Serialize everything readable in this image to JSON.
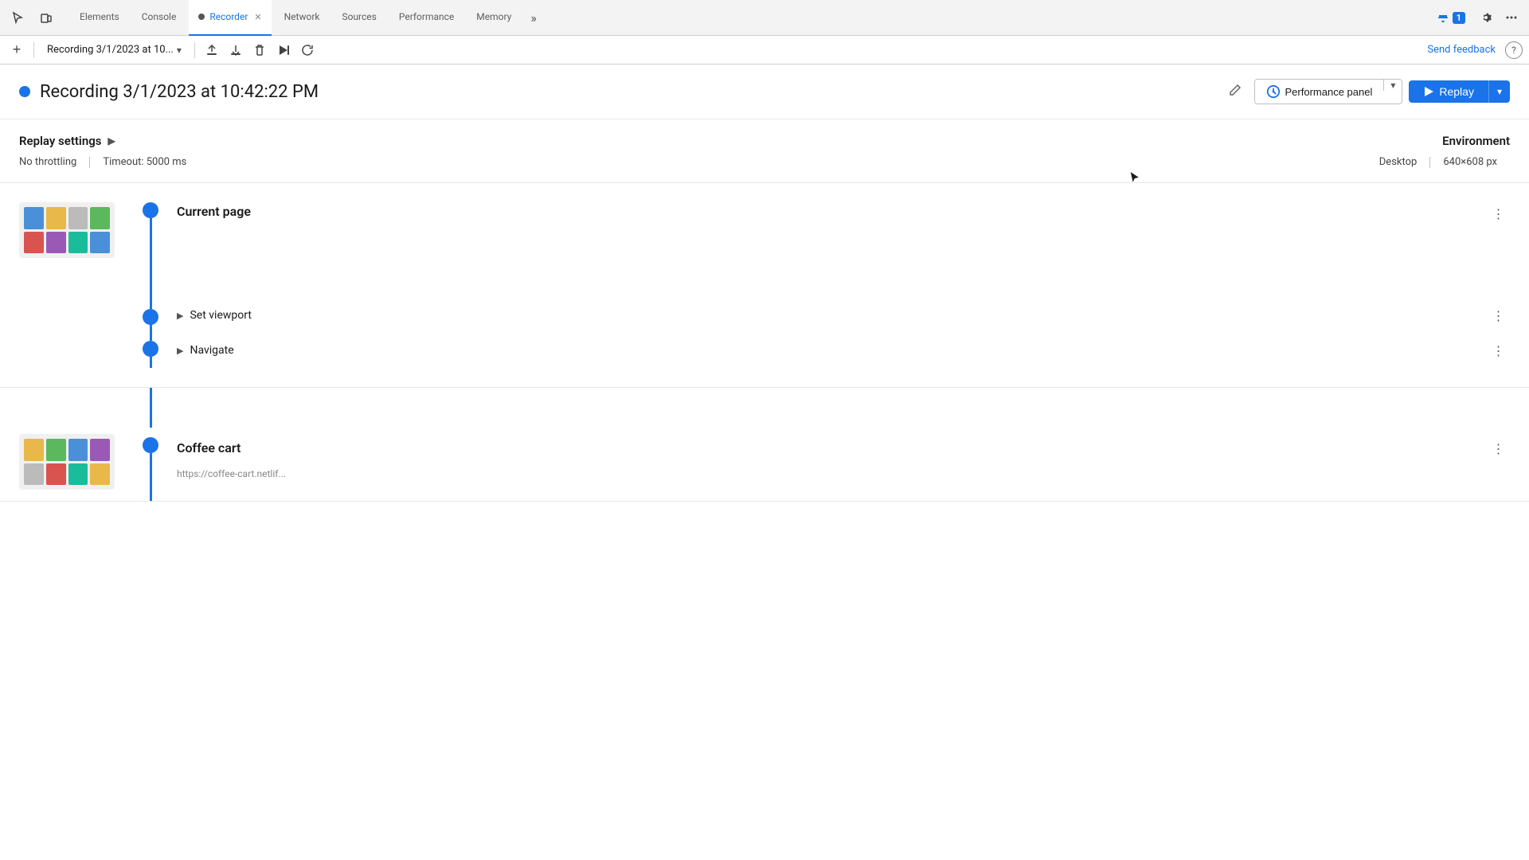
{
  "tabs": {
    "items": [
      {
        "label": "Elements",
        "active": false
      },
      {
        "label": "Console",
        "active": false
      },
      {
        "label": "Recorder",
        "active": true,
        "hasClose": true,
        "hasRecordDot": true
      },
      {
        "label": "Network",
        "active": false
      },
      {
        "label": "Sources",
        "active": false
      },
      {
        "label": "Performance",
        "active": false
      },
      {
        "label": "Memory",
        "active": false
      }
    ],
    "more_label": "»",
    "notifications": "1"
  },
  "toolbar": {
    "add_label": "+",
    "recording_name": "Recording 3/1/2023 at 10...",
    "send_feedback": "Send feedback"
  },
  "header": {
    "recording_full_name": "Recording 3/1/2023 at 10:42:22 PM",
    "performance_panel_label": "Performance panel",
    "replay_label": "Replay"
  },
  "settings": {
    "title": "Replay settings",
    "arrow": "▶",
    "throttling": "No throttling",
    "timeout": "Timeout: 5000 ms",
    "env_title": "Environment",
    "env_desktop": "Desktop",
    "env_resolution": "640×608 px"
  },
  "steps": [
    {
      "id": "group1",
      "title": "Current page",
      "url": "",
      "has_thumbnail": true,
      "sub_steps": [
        {
          "label": "Set viewport",
          "expandable": true
        },
        {
          "label": "Navigate",
          "expandable": true
        }
      ]
    },
    {
      "id": "group2",
      "title": "Coffee cart",
      "url": "https://coffee-cart.netlif...",
      "has_thumbnail": true,
      "sub_steps": []
    }
  ],
  "icons": {
    "cursor": "↖",
    "pointer_select": "↖",
    "device_toggle": "⊡",
    "upload": "↑",
    "download": "↓",
    "delete": "🗑",
    "play_once": "▷|",
    "loop": "↺",
    "caret_down": "▾",
    "edit": "✎",
    "three_dots": "⋮",
    "triangle_right": "▶",
    "gear": "⚙",
    "more_tabs": "»",
    "help": "?",
    "chat": "💬",
    "replay_icon": "▷",
    "perf_icon": "⟳"
  },
  "colors": {
    "blue": "#1a73e8",
    "blue_dot": "#1a73e8",
    "tab_border": "#1a73e8"
  }
}
